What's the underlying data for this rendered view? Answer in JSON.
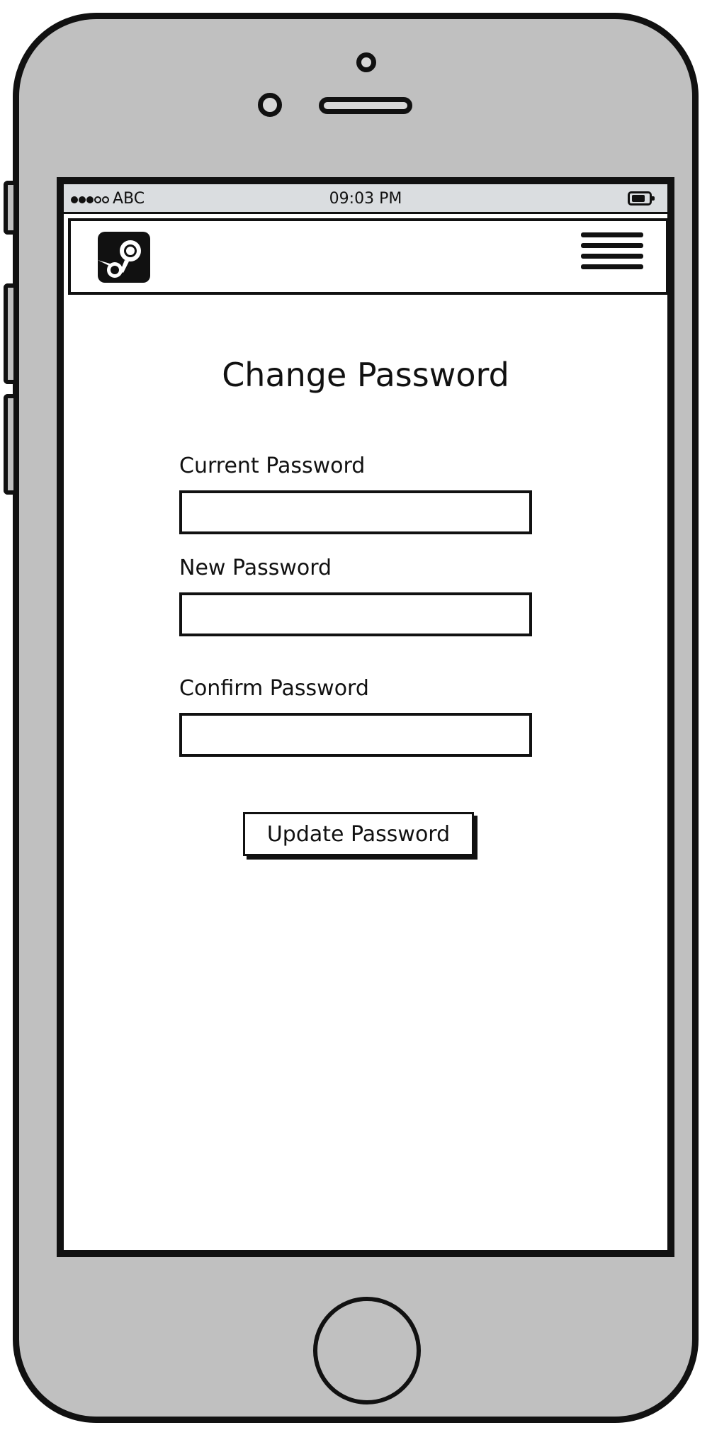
{
  "status_bar": {
    "carrier": "ABC",
    "time": "09:03 PM",
    "signal_filled": 3,
    "signal_total": 5
  },
  "header": {
    "logo_icon": "steam-logo-icon",
    "menu_icon": "hamburger-menu-icon"
  },
  "page": {
    "title": "Change Password"
  },
  "form": {
    "current_password_label": "Current Password",
    "current_password_value": "",
    "new_password_label": "New Password",
    "new_password_value": "",
    "confirm_password_label": "Confirm Password",
    "confirm_password_value": "",
    "submit_label": "Update Password"
  },
  "device": {
    "body_color": "#c0c0c0",
    "outline_color": "#111111",
    "status_bar_color": "#dadde0"
  }
}
